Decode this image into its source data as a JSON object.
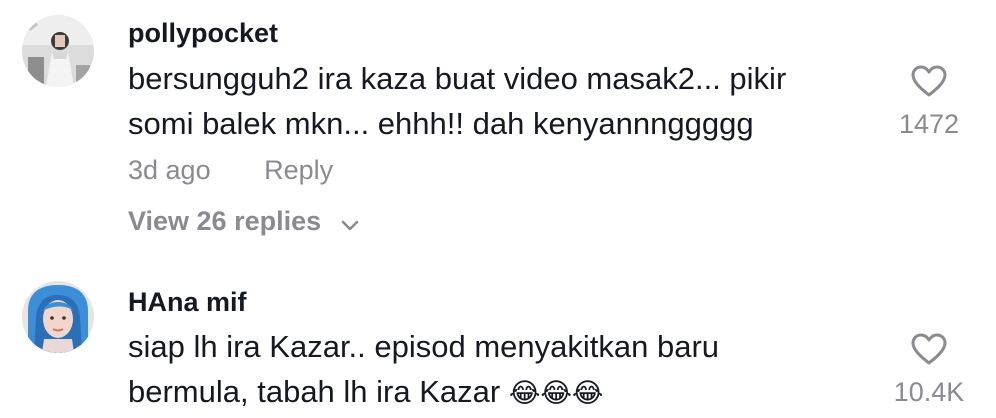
{
  "comments": [
    {
      "username": "pollypocket",
      "lines": [
        "bersungguh2 ira kaza buat video masak2... pikir",
        "somi balek mkn... ehhh!! dah kenyannnggggg"
      ],
      "time": "3d ago",
      "reply_label": "Reply",
      "view_replies": "View 26 replies",
      "likes": "1472",
      "avatar_icon": "avatar-photo",
      "heart_icon": "heart-outline-icon"
    },
    {
      "username": "HAna mif",
      "lines": [
        "siap lh ira Kazar.. episod menyakitkan baru",
        "bermula, tabah lh ira Kazar "
      ],
      "emoji": "😂😂😂",
      "likes": "10.4K",
      "avatar_icon": "avatar-photo",
      "heart_icon": "heart-outline-icon"
    }
  ],
  "colors": {
    "text": "#161823",
    "muted": "#8a8b91",
    "background": "#ffffff"
  }
}
